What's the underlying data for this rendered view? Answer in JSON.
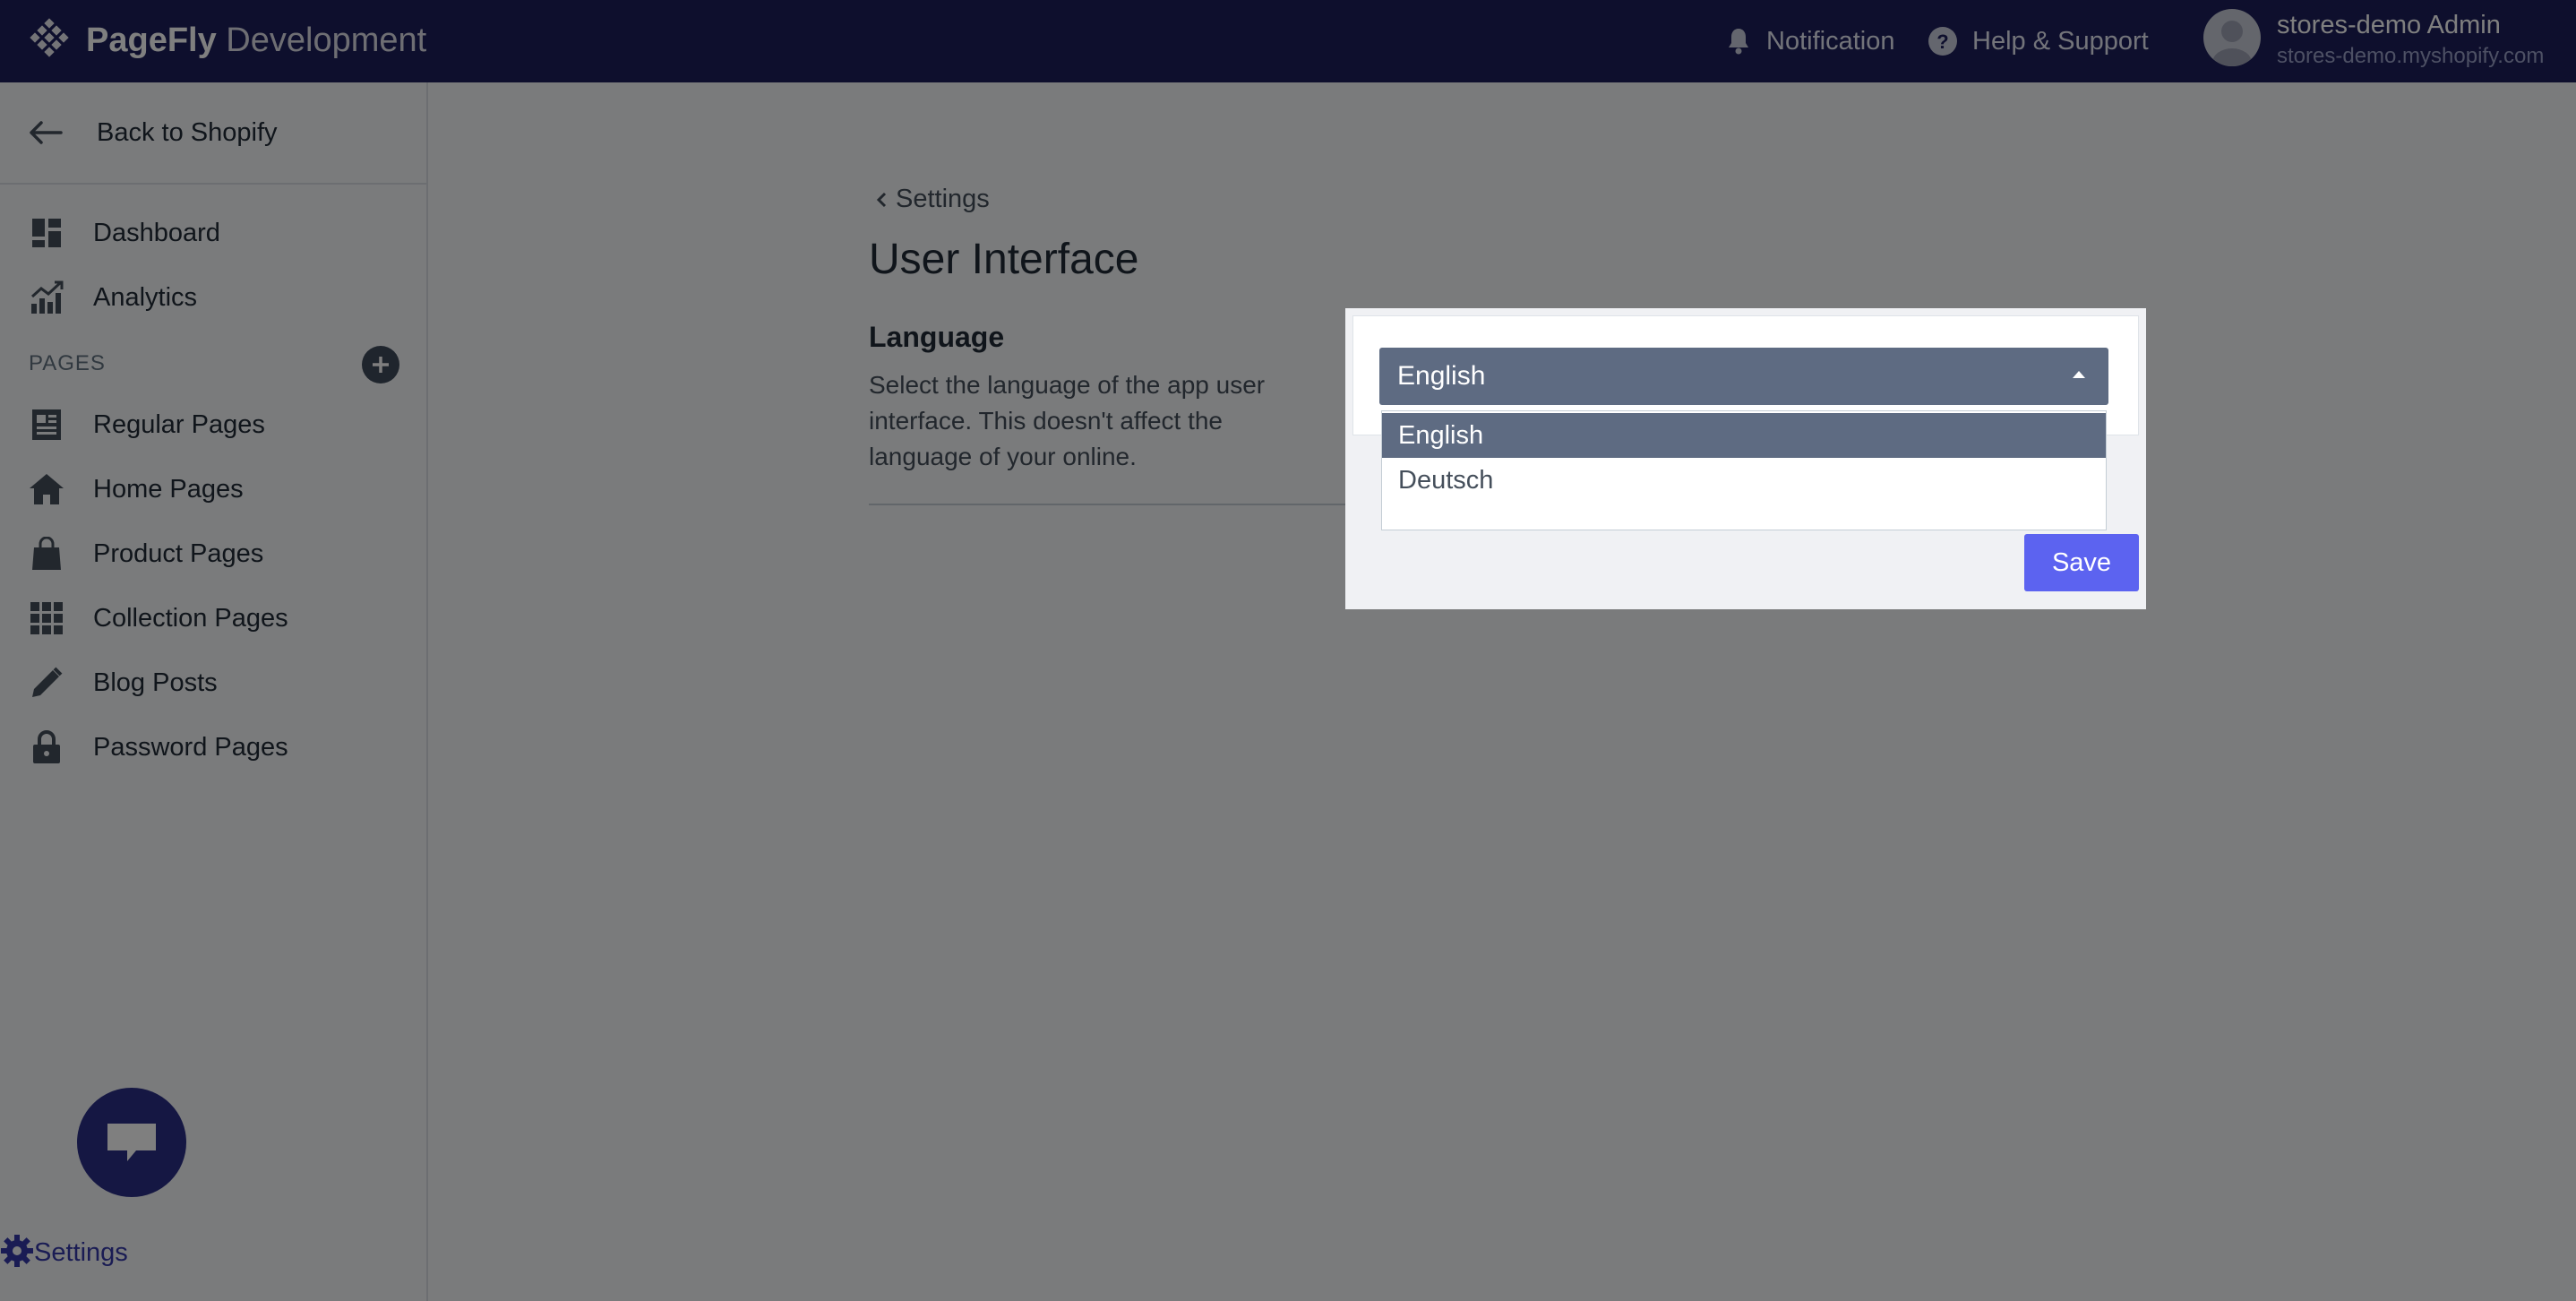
{
  "header": {
    "brand_bold": "PageFly",
    "brand_light": "Development",
    "notification_label": "Notification",
    "help_label": "Help & Support",
    "user_name": "stores-demo Admin",
    "user_store": "stores-demo.myshopify.com",
    "icons": [
      "pagefly-logo-icon",
      "bell-icon",
      "help-icon",
      "avatar"
    ]
  },
  "sidebar": {
    "back_label": "Back to Shopify",
    "top_items": [
      {
        "label": "Dashboard",
        "icon": "dashboard-icon"
      },
      {
        "label": "Analytics",
        "icon": "analytics-icon"
      }
    ],
    "section_title": "PAGES",
    "page_items": [
      {
        "label": "Regular Pages",
        "icon": "regular-pages-icon"
      },
      {
        "label": "Home Pages",
        "icon": "home-icon"
      },
      {
        "label": "Product Pages",
        "icon": "bag-icon"
      },
      {
        "label": "Collection Pages",
        "icon": "grid-icon"
      },
      {
        "label": "Blog Posts",
        "icon": "pencil-icon"
      },
      {
        "label": "Password Pages",
        "icon": "lock-icon"
      }
    ],
    "settings_label": "Settings"
  },
  "main": {
    "breadcrumb": "Settings",
    "title": "User Interface",
    "section_heading": "Language",
    "section_desc": "Select the language of the app user interface. This doesn't affect the language of your online."
  },
  "modal": {
    "selected_value": "English",
    "options": [
      "English",
      "Deutsch"
    ],
    "save_label": "Save"
  },
  "colors": {
    "topbar": "#1c1f5a",
    "accent": "#5c63f0",
    "select_bg": "#5e6b82",
    "settings_active": "#3438a8"
  }
}
